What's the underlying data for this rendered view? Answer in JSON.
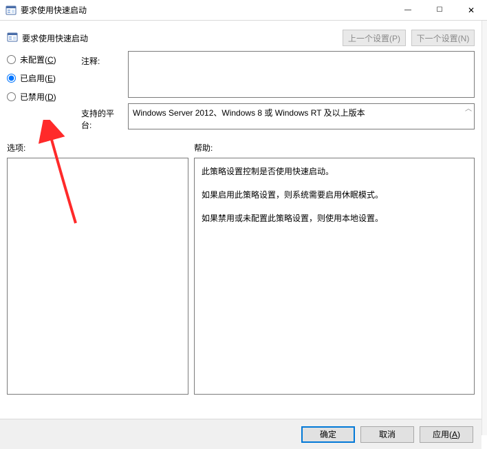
{
  "titlebar": {
    "title": "要求使用快速启动",
    "minimize_glyph": "—",
    "maximize_glyph": "☐",
    "close_glyph": "✕"
  },
  "header": {
    "subtitle": "要求使用快速启动",
    "prev_btn": "上一个设置(P)",
    "next_btn": "下一个设置(N)"
  },
  "radios": {
    "not_configured": {
      "label": "未配置(",
      "accel": "C",
      "tail": ")"
    },
    "enabled": {
      "label": "已启用(",
      "accel": "E",
      "tail": ")"
    },
    "disabled": {
      "label": "已禁用(",
      "accel": "D",
      "tail": ")"
    },
    "selected": "enabled"
  },
  "labels": {
    "comment": "注释:",
    "platform": "支持的平台:",
    "options": "选项:",
    "help": "帮助:"
  },
  "platform_text": "Windows Server 2012、Windows 8 或 Windows RT 及以上版本",
  "chevron": "︿",
  "help_paragraphs": [
    "此策略设置控制是否使用快速启动。",
    "如果启用此策略设置，则系统需要启用休眠模式。",
    "如果禁用或未配置此策略设置，则使用本地设置。"
  ],
  "footer": {
    "ok": "确定",
    "cancel": "取消",
    "apply": {
      "label": "应用(",
      "accel": "A",
      "tail": ")"
    }
  }
}
